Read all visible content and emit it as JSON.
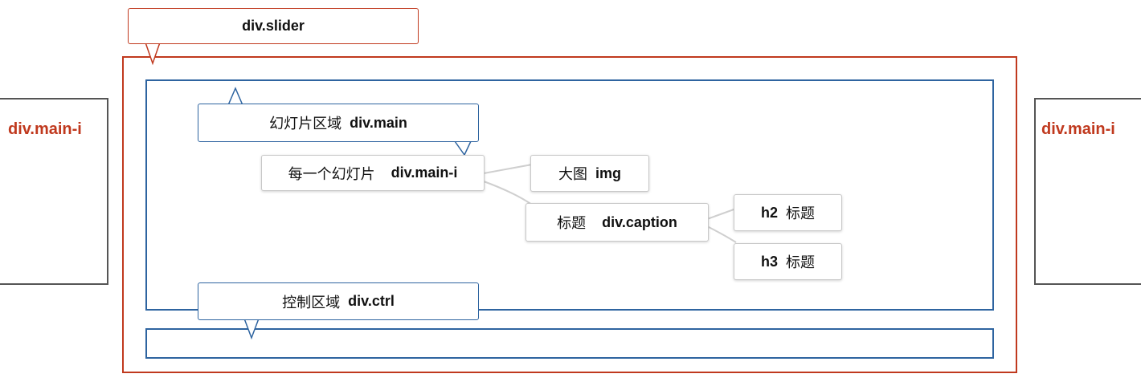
{
  "nodes": {
    "slider": {
      "code": "div.slider"
    },
    "main": {
      "text": "幻灯片区域",
      "code": "div.main"
    },
    "main_i": {
      "text": "每一个幻灯片",
      "code": "div.main-i"
    },
    "img": {
      "text": "大图",
      "code": "img"
    },
    "caption": {
      "text": "标题",
      "code": "div.caption"
    },
    "h2": {
      "code": "h2",
      "text": "标题"
    },
    "h3": {
      "code": "h3",
      "text": "标题"
    },
    "ctrl": {
      "text": "控制区域",
      "code": "div.ctrl"
    },
    "side_left": {
      "code": "div.main-i"
    },
    "side_right": {
      "code": "div.main-i"
    }
  },
  "colors": {
    "slider_border": "#c0391e",
    "inner_border": "#2e64a0",
    "side_border": "#555555",
    "side_label": "#c0391e"
  }
}
